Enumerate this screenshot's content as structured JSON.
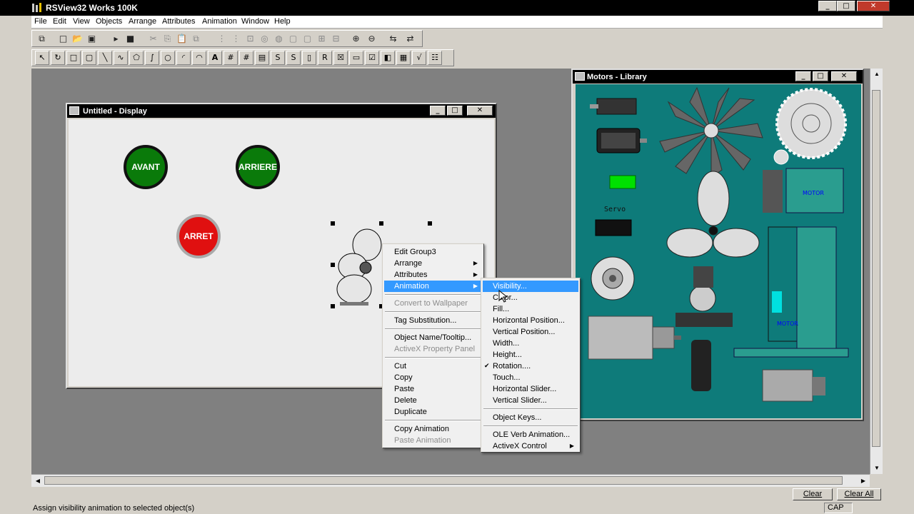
{
  "app": {
    "title": "RSView32 Works 100K",
    "caption_min": "_",
    "caption_max": "□",
    "caption_close": "✕"
  },
  "menubar": {
    "items": [
      "File",
      "Edit",
      "View",
      "Objects",
      "Arrange",
      "Attributes",
      "Animation",
      "Window",
      "Help"
    ]
  },
  "display_window": {
    "title": "Untitled - Display",
    "btn_min": "_",
    "btn_max": "□",
    "btn_close": "✕",
    "buttons": [
      {
        "label": "AVANT",
        "color": "#0a7a0a"
      },
      {
        "label": "ARRIERE",
        "color": "#0a7a0a"
      },
      {
        "label": "ARRET",
        "color": "#e01010"
      }
    ]
  },
  "library_window": {
    "title": "Motors - Library",
    "btn_min": "_",
    "btn_max": "□",
    "btn_close": "✕",
    "servo_label": "Servo",
    "motor_label_1": "MOTOR",
    "motor_label_2": "MOTOR"
  },
  "context_menu": {
    "items": [
      {
        "label": "Edit Group3",
        "disabled": false,
        "submenu": false
      },
      {
        "label": "Arrange",
        "disabled": false,
        "submenu": true
      },
      {
        "label": "Attributes",
        "disabled": false,
        "submenu": true
      },
      {
        "label": "Animation",
        "disabled": false,
        "submenu": true,
        "highlighted": true
      },
      {
        "label": "Convert to Wallpaper",
        "disabled": true
      },
      {
        "label": "Tag Substitution...",
        "disabled": false
      },
      {
        "label": "Object Name/Tooltip...",
        "disabled": false
      },
      {
        "label": "ActiveX Property Panel",
        "disabled": true
      },
      {
        "label": "Cut",
        "disabled": false
      },
      {
        "label": "Copy",
        "disabled": false
      },
      {
        "label": "Paste",
        "disabled": false
      },
      {
        "label": "Delete",
        "disabled": false
      },
      {
        "label": "Duplicate",
        "disabled": false
      },
      {
        "label": "Copy Animation",
        "disabled": false
      },
      {
        "label": "Paste Animation",
        "disabled": true
      }
    ]
  },
  "animation_submenu": {
    "items": [
      {
        "label": "Visibility...",
        "highlighted": true
      },
      {
        "label": "Color..."
      },
      {
        "label": "Fill..."
      },
      {
        "label": "Horizontal Position..."
      },
      {
        "label": "Vertical Position..."
      },
      {
        "label": "Width..."
      },
      {
        "label": "Height..."
      },
      {
        "label": "Rotation....",
        "checked": true
      },
      {
        "label": "Touch..."
      },
      {
        "label": "Horizontal Slider..."
      },
      {
        "label": "Vertical Slider..."
      },
      {
        "label": "Object Keys..."
      },
      {
        "label": "OLE Verb Animation..."
      },
      {
        "label": "ActiveX Control",
        "submenu": true
      }
    ],
    "check_mark": "✔"
  },
  "status": {
    "message": "Assign visibility animation to selected object(s)",
    "cap": "CAP",
    "clear": "Clear",
    "clear_all": "Clear All"
  }
}
